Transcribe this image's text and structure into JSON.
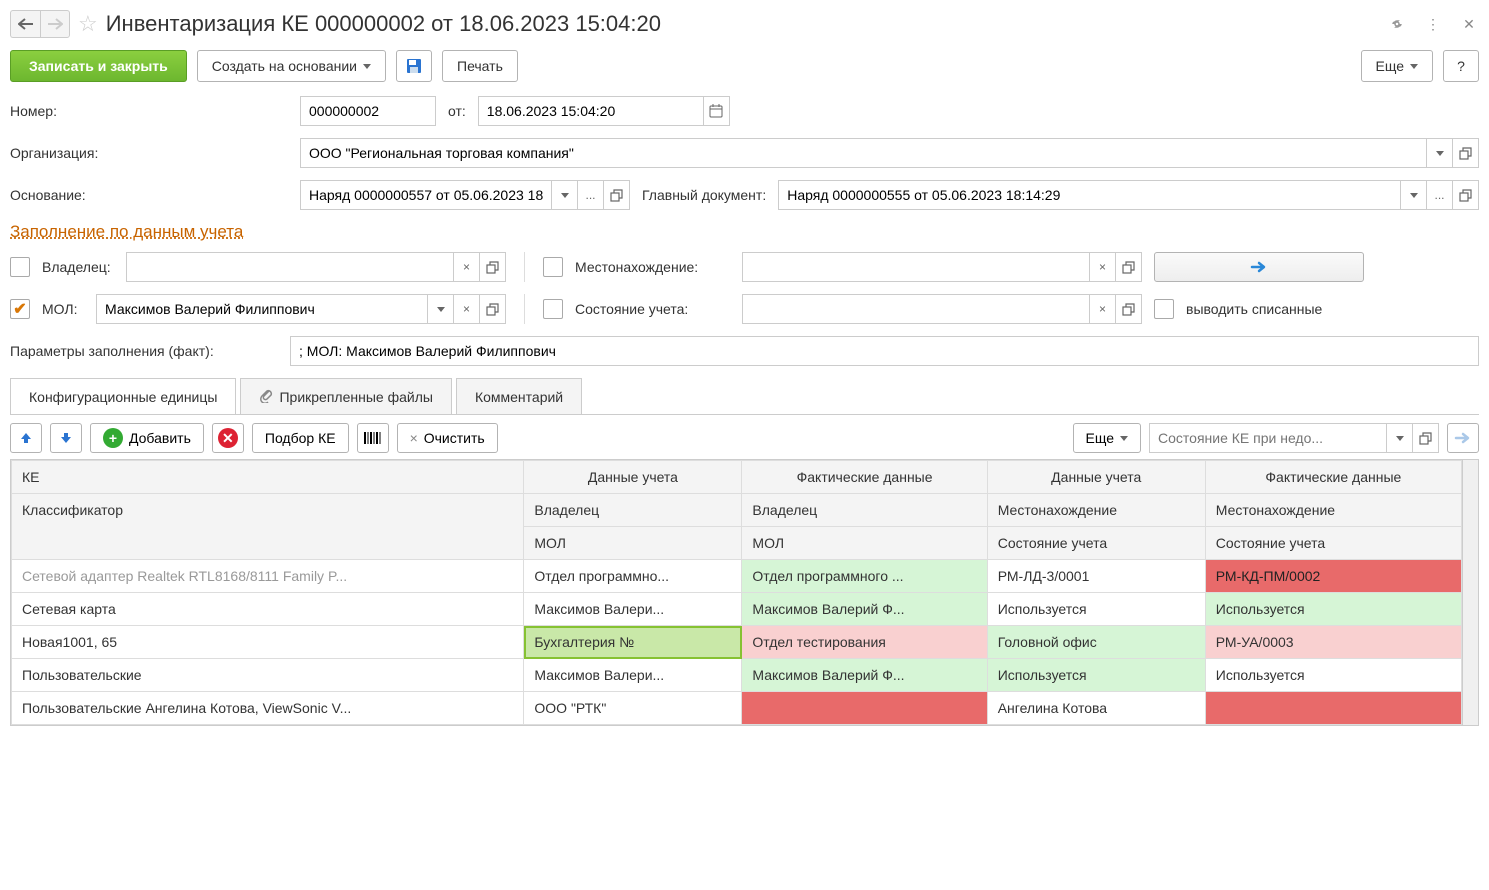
{
  "title": "Инвентаризация КЕ 000000002 от 18.06.2023 15:04:20",
  "toolbar": {
    "save_close": "Записать и закрыть",
    "create_based": "Создать на основании",
    "print": "Печать",
    "more": "Еще",
    "help": "?"
  },
  "form": {
    "number_label": "Номер:",
    "number": "000000002",
    "from_label": "от:",
    "date": "18.06.2023 15:04:20",
    "org_label": "Организация:",
    "org": "ООО \"Региональная торговая компания\"",
    "basis_label": "Основание:",
    "basis": "Наряд 0000000557 от 05.06.2023 18:",
    "main_doc_label": "Главный документ:",
    "main_doc": "Наряд 0000000555 от 05.06.2023 18:14:29",
    "fill_link": "Заполнение по данным учета",
    "owner_label": "Владелец:",
    "owner": "",
    "location_label": "Местонахождение:",
    "location": "",
    "mol_label": "МОЛ:",
    "mol": "Максимов Валерий Филиппович",
    "status_label": "Состояние учета:",
    "status": "",
    "show_written_off": "выводить списанные",
    "params_label": "Параметры заполнения (факт):",
    "params": "; МОЛ: Максимов Валерий Филиппович"
  },
  "tabs": {
    "ce": "Конфигурационные единицы",
    "files": "Прикрепленные файлы",
    "comment": "Комментарий"
  },
  "sub_toolbar": {
    "add": "Добавить",
    "select_ke": "Подбор КЕ",
    "clear": "Очистить",
    "more": "Еще",
    "status_placeholder": "Состояние КЕ при недо..."
  },
  "table": {
    "headers": {
      "ke": "КЕ",
      "data_acc": "Данные учета",
      "data_fact": "Фактические данные",
      "classifier": "Классификатор",
      "owner": "Владелец",
      "mol": "МОЛ",
      "location": "Местонахождение",
      "status": "Состояние учета"
    },
    "rows": [
      {
        "ke": "Сетевой адаптер Realtek RTL8168/8111 Family P...",
        "classifier": "Сетевая карта",
        "acc_owner": "Отдел программно...",
        "fact_owner": "Отдел программного ...",
        "acc_mol": "Максимов Валери...",
        "fact_mol": "Максимов Валерий Ф...",
        "acc_loc": "РМ-ЛД-3/0001",
        "fact_loc": "РМ-КД-ПМ/0002",
        "acc_status": "Используется",
        "fact_status": "Используется",
        "ke_muted": true,
        "fact_owner_class": "cell-lightgreen",
        "fact_mol_class": "cell-lightgreen",
        "fact_loc_class": "cell-red",
        "fact_status_class": "cell-lightgreen"
      },
      {
        "ke": "Новая1001, 65",
        "classifier": "Пользовательские",
        "acc_owner": "Бухгалтерия №",
        "fact_owner": "Отдел тестирования",
        "acc_mol": "Максимов Валери...",
        "fact_mol": "Максимов Валерий Ф...",
        "acc_loc": "Головной офис",
        "fact_loc": "РМ-УА/0003",
        "acc_status": "Используется",
        "fact_status": "Используется",
        "acc_owner_class": "cell-green-sel",
        "fact_owner_class": "cell-lightred",
        "fact_mol_class": "cell-lightgreen",
        "acc_loc_class": "cell-lightgreen",
        "fact_loc_class": "cell-lightred",
        "acc_status_class": "cell-lightgreen"
      },
      {
        "ke": "Пользовательские Ангелина Котова, ViewSonic V...",
        "classifier": "",
        "acc_owner": "ООО \"РТК\"",
        "fact_owner": "",
        "acc_mol": "",
        "fact_mol": "",
        "acc_loc": "Ангелина Котова",
        "fact_loc": "",
        "acc_status": "",
        "fact_status": "",
        "fact_owner_class": "cell-red",
        "fact_loc_class": "cell-red"
      }
    ]
  }
}
